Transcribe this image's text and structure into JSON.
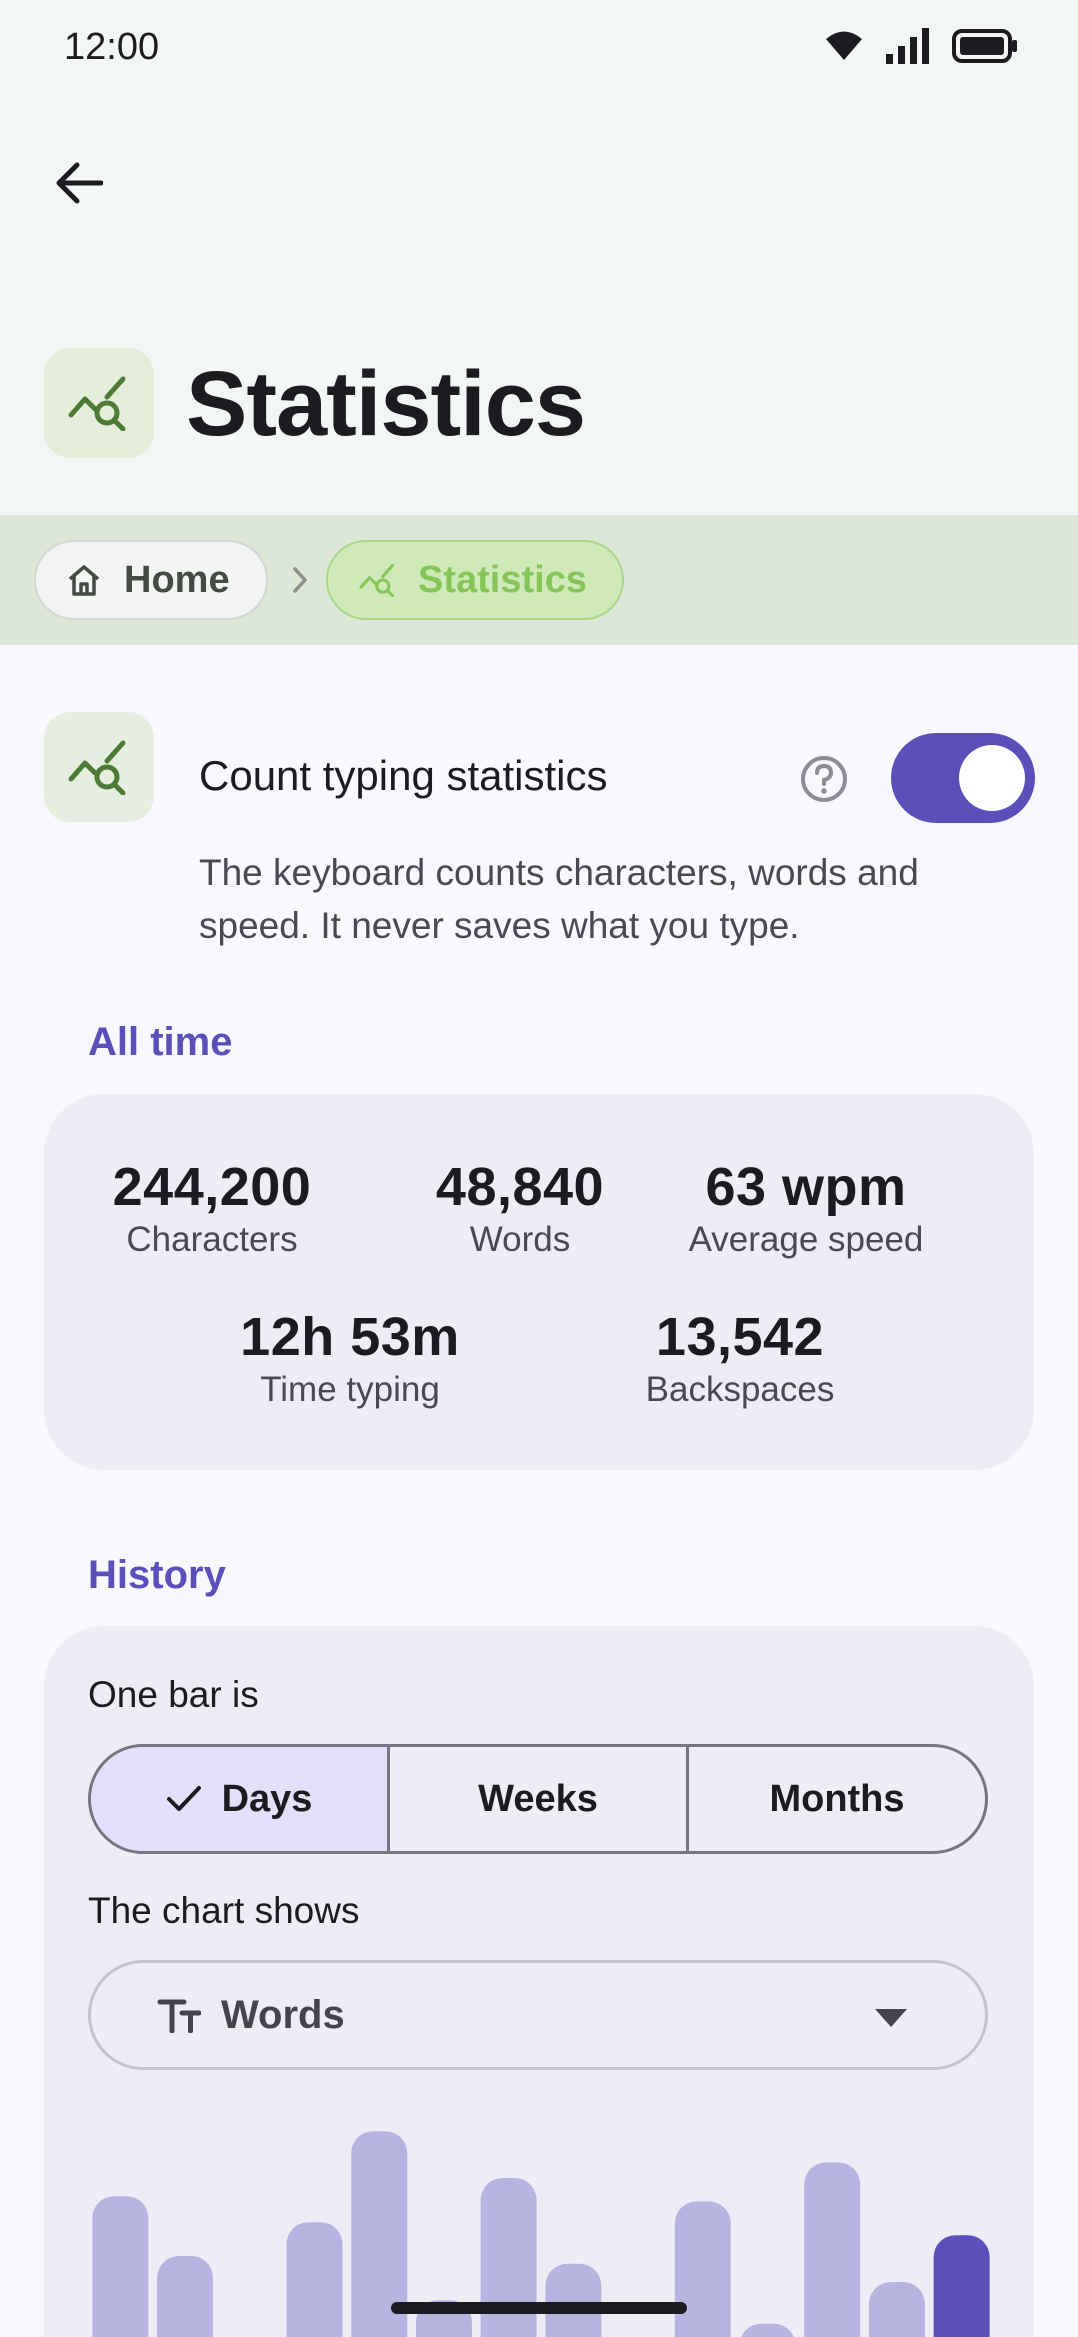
{
  "status_bar": {
    "time": "12:00"
  },
  "header": {
    "title": "Statistics"
  },
  "breadcrumb": {
    "home": "Home",
    "current": "Statistics"
  },
  "setting": {
    "title": "Count typing statistics",
    "description": "The keyboard counts characters, words and speed. It never saves what you type.",
    "enabled": true
  },
  "all_time": {
    "label": "All time",
    "stats": [
      {
        "value": "244,200",
        "label": "Characters"
      },
      {
        "value": "48,840",
        "label": "Words"
      },
      {
        "value": "63 wpm",
        "label": "Average speed"
      },
      {
        "value": "12h 53m",
        "label": "Time typing"
      },
      {
        "value": "13,542",
        "label": "Backspaces"
      }
    ]
  },
  "history": {
    "label": "History",
    "bar_label": "One bar is",
    "options": [
      "Days",
      "Weeks",
      "Months"
    ],
    "selected": "Days",
    "chart_label": "The chart shows",
    "chart_value": "Words"
  },
  "chart_data": {
    "type": "bar",
    "values": [
      0.73,
      0.5,
      0.17,
      0.63,
      0.98,
      0.33,
      0.8,
      0.47,
      0.0,
      0.71,
      0.24,
      0.86,
      0.4,
      0.58
    ],
    "highlight_last": true,
    "colors": {
      "bar": "#b8b4e2",
      "highlight": "#5b4fba"
    }
  }
}
